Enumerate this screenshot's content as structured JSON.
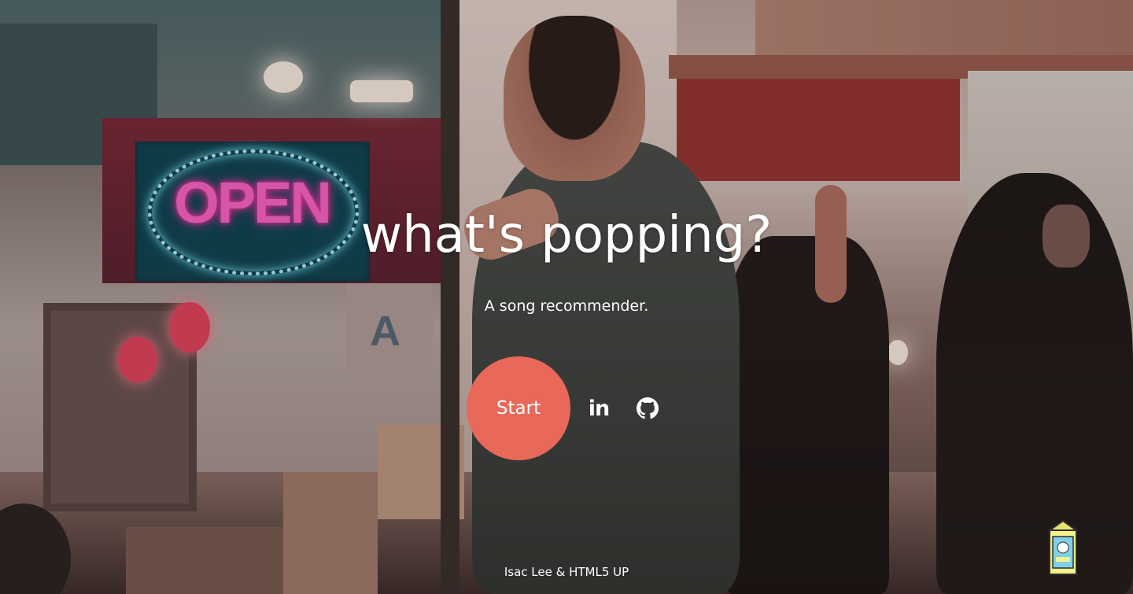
{
  "hero": {
    "title": "what's popping?",
    "subtitle": "A song recommender."
  },
  "actions": {
    "start_label": "Start"
  },
  "social": {
    "linkedin_icon": "linkedin-icon",
    "github_icon": "github-icon",
    "linkedin_text": "in"
  },
  "footer": {
    "credit": "Isac Lee & HTML5 UP"
  },
  "background": {
    "neon_sign_text": "OPEN",
    "board_letter": "A"
  },
  "colors": {
    "start_button": "#e8685a",
    "text": "#ffffff"
  }
}
